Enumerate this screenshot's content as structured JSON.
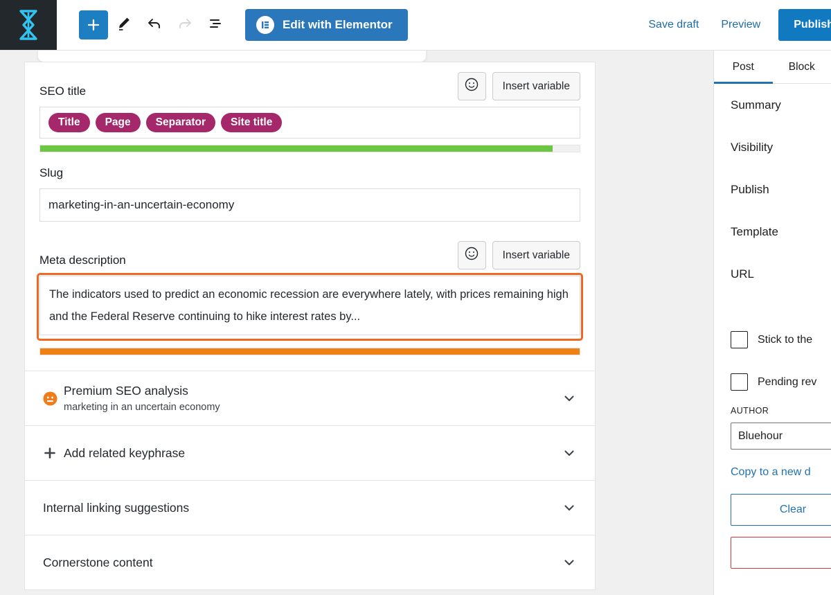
{
  "toolbar": {
    "logo_icon": "site-logo-hourglass-icon",
    "add_block_label": "+",
    "add_block_icon": "plus-icon",
    "tools_icon": "pencil-icon",
    "undo_icon": "undo-arrow-icon",
    "redo_icon": "redo-arrow-icon",
    "list_view_icon": "list-view-icon",
    "elementor_icon": "elementor-logo-icon",
    "elementor_label": "Edit with Elementor",
    "save_draft_label": "Save draft",
    "preview_label": "Preview",
    "publish_label": "Publish",
    "accent_blue": "#1d7ec1",
    "publish_blue": "#1179bf"
  },
  "seo": {
    "title_field": {
      "label": "SEO title",
      "smiley_icon": "smiley-face-icon",
      "insert_variable_label": "Insert variable",
      "tags": [
        "Title",
        "Page",
        "Separator",
        "Site title"
      ],
      "tag_color": "#a4286a",
      "progress_percent": 95,
      "progress_color": "#6cc644"
    },
    "slug_field": {
      "label": "Slug",
      "value": "marketing-in-an-uncertain-economy"
    },
    "meta_description_field": {
      "label": "Meta description",
      "smiley_icon": "smiley-face-icon",
      "insert_variable_label": "Insert variable",
      "value": "The indicators used to predict an economic recession are everywhere lately, with prices remaining high and the Federal Reserve continuing to hike interest rates by...",
      "focused": true,
      "focus_color": "#f26724",
      "progress_percent": 100,
      "progress_color": "#ef8014"
    },
    "rows": [
      {
        "title": "Premium SEO analysis",
        "subtitle": "marketing in an uncertain economy",
        "icon": "seo-score-neutral-face-icon",
        "icon_color": "#ee7c1b",
        "chevron_icon": "chevron-down-icon"
      },
      {
        "title": "Add related keyphrase",
        "subtitle": "",
        "icon": "plus-icon",
        "icon_color": "#555d66",
        "chevron_icon": "chevron-down-icon"
      },
      {
        "title": "Internal linking suggestions",
        "subtitle": "",
        "icon": "",
        "icon_color": "",
        "chevron_icon": "chevron-down-icon"
      },
      {
        "title": "Cornerstone content",
        "subtitle": "",
        "icon": "",
        "icon_color": "",
        "chevron_icon": "chevron-down-icon"
      }
    ]
  },
  "sidebar": {
    "tabs": [
      {
        "label": "Post",
        "active": true
      },
      {
        "label": "Block",
        "active": false
      }
    ],
    "active_tab_color": "#2271b1",
    "items": [
      {
        "label": "Summary"
      },
      {
        "label": "Visibility"
      },
      {
        "label": "Publish"
      },
      {
        "label": "Template"
      },
      {
        "label": "URL"
      }
    ],
    "checkboxes": [
      {
        "label": "Stick to the",
        "checked": false
      },
      {
        "label": "Pending rev",
        "checked": false
      }
    ],
    "author_caption": "AUTHOR",
    "author_value": "Bluehour",
    "copy_link_label": "Copy to a new d",
    "clear_button_label": "Clear",
    "trash_button_label": ""
  }
}
